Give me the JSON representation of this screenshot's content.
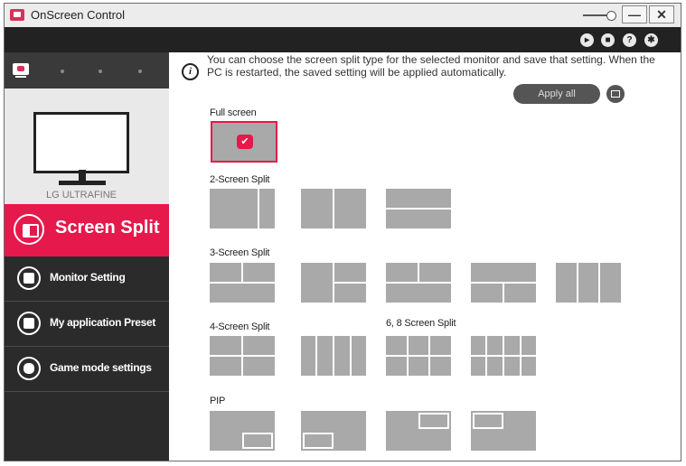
{
  "window": {
    "title": "OnScreen Control",
    "min_label": "—",
    "close_label": "✕"
  },
  "topbar": {
    "icons": [
      "pointer-icon",
      "display-icon",
      "help-icon",
      "settings-icon"
    ],
    "help_glyph": "?"
  },
  "sidebar": {
    "monitor_name": "LG ULTRAFINE",
    "active_item": "Screen Split",
    "items": [
      {
        "label": "Monitor Setting",
        "icon": "monitor-setting-icon"
      },
      {
        "label": "My application Preset",
        "icon": "app-preset-icon"
      },
      {
        "label": "Game mode settings",
        "icon": "gamepad-icon"
      }
    ]
  },
  "content": {
    "info_line1": "You can choose the screen split type for the selected monitor and save that setting. When the",
    "info_line2": "PC is restarted, the saved setting will be applied automatically.",
    "info_glyph": "i",
    "apply_all": "Apply all",
    "sections": {
      "full": "Full screen",
      "two": "2-Screen Split",
      "three": "3-Screen Split",
      "four": "4-Screen Split",
      "six_eight": "6, 8 Screen Split",
      "pip": "PIP"
    },
    "selected_check": "✔"
  },
  "colors": {
    "accent": "#e5194c",
    "sidebar_bg": "#2b2b2b",
    "topbar_bg": "#222222",
    "thumb": "#a9a9a9"
  }
}
